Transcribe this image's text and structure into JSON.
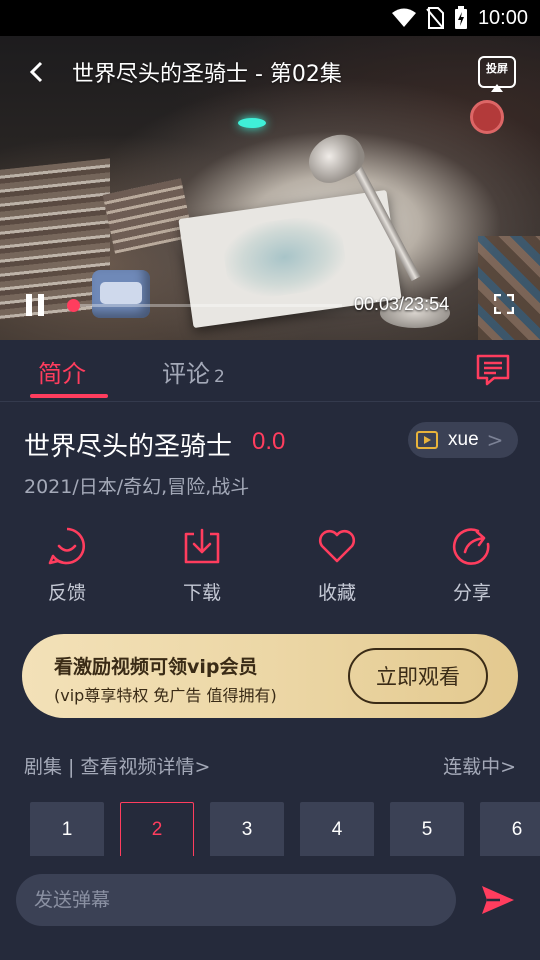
{
  "status_bar": {
    "time": "10:00"
  },
  "video": {
    "title": "世界尽头的圣骑士 - 第02集",
    "cast_label": "投屏",
    "time": "00:03/23:54",
    "progress": 0.0021
  },
  "tabs": {
    "intro": "简介",
    "comments": "评论",
    "comments_count": "2"
  },
  "show": {
    "title": "世界尽头的圣骑士",
    "score": "0.0",
    "source": "xue",
    "meta": "2021/日本/奇幻,冒险,战斗"
  },
  "actions": [
    {
      "label": "反馈",
      "icon": "smile-bubble-icon"
    },
    {
      "label": "下载",
      "icon": "download-icon"
    },
    {
      "label": "收藏",
      "icon": "heart-icon"
    },
    {
      "label": "分享",
      "icon": "share-icon"
    }
  ],
  "vip_banner": {
    "title": "看激励视频可领vip会员",
    "subtitle": "(vip尊享特权 免广告 值得拥有)",
    "button": "立即观看"
  },
  "episodes": {
    "header": "剧集 | 查看视频详情>",
    "status": "连载中>",
    "items": [
      "1",
      "2",
      "3",
      "4",
      "5",
      "6"
    ],
    "active": "2"
  },
  "danmaku": {
    "placeholder": "发送弹幕"
  },
  "colors": {
    "accent": "#ff3d5e",
    "background": "#252a3b",
    "card": "#3b4155",
    "gold": "#ecd7a6"
  }
}
